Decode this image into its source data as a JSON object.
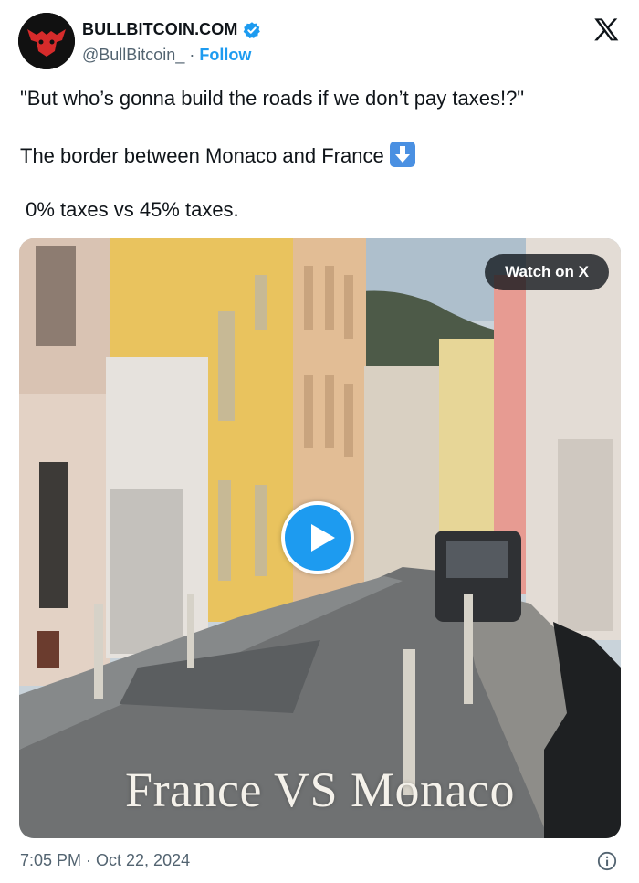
{
  "header": {
    "display_name": "BULLBITCOIN.COM",
    "handle": "@BullBitcoin_",
    "separator": "·",
    "follow_label": "Follow",
    "verified": true
  },
  "tweet": {
    "line1": "\"But who’s gonna build the roads if we don’t pay taxes!?\"",
    "line2": "The border between Monaco and France",
    "line2_emoji": "down-arrow-emoji",
    "line3": " 0% taxes vs 45% taxes."
  },
  "media": {
    "watch_label": "Watch on X",
    "caption": "France VS Monaco",
    "type": "video"
  },
  "footer": {
    "timestamp": "7:05 PM · Oct 22, 2024"
  },
  "icons": {
    "verified": "verified-badge-icon",
    "logo": "x-logo-icon",
    "info": "info-icon",
    "play": "play-icon"
  },
  "colors": {
    "accent": "#1d9bf0",
    "text": "#0f1419",
    "secondary": "#536471"
  }
}
